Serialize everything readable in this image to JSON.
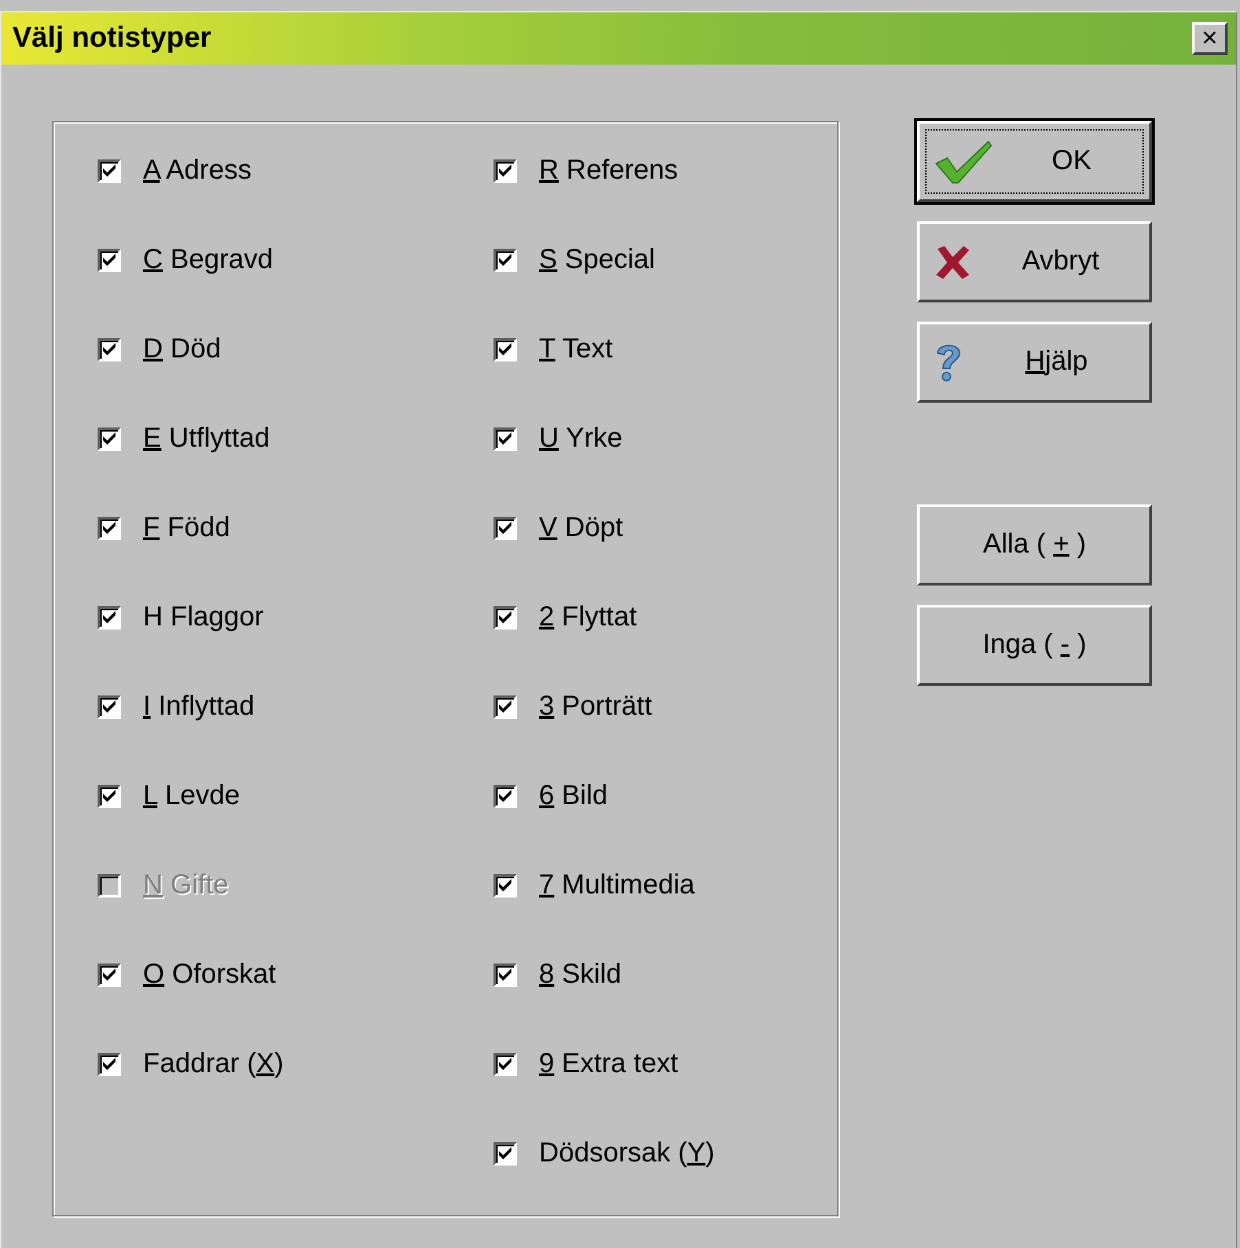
{
  "window": {
    "title": "Välj notistyper",
    "close": "×"
  },
  "columns": [
    [
      {
        "label": "A Adress",
        "underline_first": true,
        "checked": true,
        "disabled": false
      },
      {
        "label": "C Begravd",
        "underline_first": true,
        "checked": true,
        "disabled": false
      },
      {
        "label": "D Död",
        "underline_first": true,
        "checked": true,
        "disabled": false
      },
      {
        "label": "E Utflyttad",
        "underline_first": true,
        "checked": true,
        "disabled": false
      },
      {
        "label": "F Född",
        "underline_first": true,
        "checked": true,
        "disabled": false
      },
      {
        "label": "H Flaggor",
        "checked": true,
        "disabled": false
      },
      {
        "label": "I Inflyttad",
        "underline_first": true,
        "checked": true,
        "disabled": false
      },
      {
        "label": "L Levde",
        "underline_first": true,
        "checked": true,
        "disabled": false
      },
      {
        "label": "N Gifte",
        "underline_first": true,
        "checked": false,
        "disabled": true
      },
      {
        "label": "O Oforskat",
        "underline_first": true,
        "checked": true,
        "disabled": false
      },
      {
        "label": "Faddrar (X)",
        "underline_last": true,
        "checked": true,
        "disabled": false
      }
    ],
    [
      {
        "label": "R Referens",
        "underline_first": true,
        "checked": true,
        "disabled": false
      },
      {
        "label": "S Special",
        "underline_first": true,
        "checked": true,
        "disabled": false
      },
      {
        "label": "T Text",
        "underline_first": true,
        "checked": true,
        "disabled": false
      },
      {
        "label": "U Yrke",
        "underline_first": true,
        "checked": true,
        "disabled": false
      },
      {
        "label": "V Döpt",
        "underline_first": true,
        "checked": true,
        "disabled": false
      },
      {
        "label": "2 Flyttat",
        "underline_first": true,
        "checked": true,
        "disabled": false
      },
      {
        "label": "3 Porträtt",
        "underline_first": true,
        "checked": true,
        "disabled": false
      },
      {
        "label": "6 Bild",
        "underline_first": true,
        "checked": true,
        "disabled": false
      },
      {
        "label": "7 Multimedia",
        "underline_first": true,
        "checked": true,
        "disabled": false
      },
      {
        "label": "8 Skild",
        "underline_first": true,
        "checked": true,
        "disabled": false
      },
      {
        "label": "9 Extra text",
        "underline_first": true,
        "checked": true,
        "disabled": false
      },
      {
        "label": "Dödsorsak (Y)",
        "underline_last": true,
        "checked": true,
        "disabled": false
      }
    ]
  ],
  "buttons": [
    {
      "label": "OK",
      "kind": "ok",
      "focused": true
    },
    {
      "label": "Avbryt",
      "kind": "cancel",
      "focused": false
    },
    {
      "label": "Hjälp",
      "kind": "help",
      "underline_first": true,
      "focused": false
    },
    {
      "label": "Alla ( + )",
      "kind": "plain",
      "underline_last": true,
      "focused": false
    },
    {
      "label": "Inga ( - )",
      "kind": "plain",
      "underline_last": true,
      "focused": false
    }
  ]
}
